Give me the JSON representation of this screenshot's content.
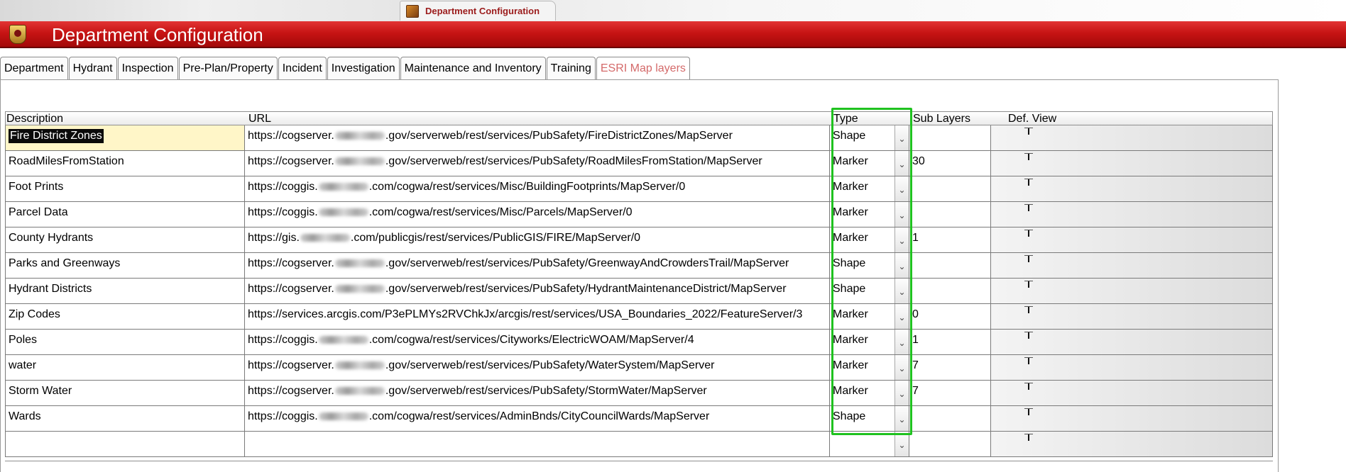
{
  "doc_tab": {
    "label": "Department Configuration"
  },
  "header": {
    "title": "Department Configuration"
  },
  "tabs": [
    {
      "label": "Department"
    },
    {
      "label": "Hydrant"
    },
    {
      "label": "Inspection"
    },
    {
      "label": "Pre-Plan/Property"
    },
    {
      "label": "Incident"
    },
    {
      "label": "Investigation"
    },
    {
      "label": "Maintenance and Inventory"
    },
    {
      "label": "Training"
    },
    {
      "label": "ESRI Map layers",
      "active": true
    }
  ],
  "grid": {
    "columns": {
      "description": "Description",
      "url": "URL",
      "type": "Type",
      "sub_layers": "Sub Layers",
      "def_view": "Def. View"
    },
    "rows": [
      {
        "description": "Fire District Zones",
        "url_pre": "https://cogserver.",
        "url_post": ".gov/serverweb/rest/services/PubSafety/FireDistrictZones/MapServer",
        "type": "Shape",
        "sub_layers": ""
      },
      {
        "description": "RoadMilesFromStation",
        "url_pre": "https://cogserver.",
        "url_post": ".gov/serverweb/rest/services/PubSafety/RoadMilesFromStation/MapServer",
        "type": "Marker",
        "sub_layers": "30"
      },
      {
        "description": "Foot Prints",
        "url_pre": "https://coggis.",
        "url_post": ".com/cogwa/rest/services/Misc/BuildingFootprints/MapServer/0",
        "type": "Marker",
        "sub_layers": ""
      },
      {
        "description": "Parcel Data",
        "url_pre": "https://coggis.",
        "url_post": ".com/cogwa/rest/services/Misc/Parcels/MapServer/0",
        "type": "Marker",
        "sub_layers": ""
      },
      {
        "description": "County Hydrants",
        "url_pre": "https://gis.",
        "url_post": ".com/publicgis/rest/services/PublicGIS/FIRE/MapServer/0",
        "type": "Marker",
        "sub_layers": "1"
      },
      {
        "description": "Parks and Greenways",
        "url_pre": "https://cogserver.",
        "url_post": ".gov/serverweb/rest/services/PubSafety/GreenwayAndCrowdersTrail/MapServer",
        "type": "Shape",
        "sub_layers": ""
      },
      {
        "description": "Hydrant Districts",
        "url_pre": "https://cogserver.",
        "url_post": ".gov/serverweb/rest/services/PubSafety/HydrantMaintenanceDistrict/MapServer",
        "type": "Shape",
        "sub_layers": ""
      },
      {
        "description": "Zip Codes",
        "url_pre": "https://services.arcgis.com/P3ePLMYs2RVChkJx/arcgis/rest/services/USA_Boundaries_2022/FeatureServer/3",
        "url_post": "",
        "type": "Marker",
        "sub_layers": "0"
      },
      {
        "description": "Poles",
        "url_pre": "https://coggis.",
        "url_post": ".com/cogwa/rest/services/Cityworks/ElectricWOAM/MapServer/4",
        "type": "Marker",
        "sub_layers": "1"
      },
      {
        "description": "water",
        "url_pre": "https://cogserver.",
        "url_post": ".gov/serverweb/rest/services/PubSafety/WaterSystem/MapServer",
        "type": "Marker",
        "sub_layers": "7"
      },
      {
        "description": "Storm Water",
        "url_pre": "https://cogserver.",
        "url_post": ".gov/serverweb/rest/services/PubSafety/StormWater/MapServer",
        "type": "Marker",
        "sub_layers": "7"
      },
      {
        "description": "Wards",
        "url_pre": "https://coggis.",
        "url_post": ".com/cogwa/rest/services/AdminBnds/CityCouncilWards/MapServer",
        "type": "Shape",
        "sub_layers": ""
      },
      {
        "description": "",
        "url_pre": "",
        "url_post": "",
        "type": "",
        "sub_layers": ""
      }
    ]
  },
  "colors": {
    "header_red": "#c71414",
    "highlight_green": "#1fc21f",
    "active_tab_text": "#d46a6a"
  },
  "icons": {
    "doc_tab": "department-config-icon",
    "header": "fire-badge-icon",
    "dropdown": "chevron-down-icon"
  }
}
